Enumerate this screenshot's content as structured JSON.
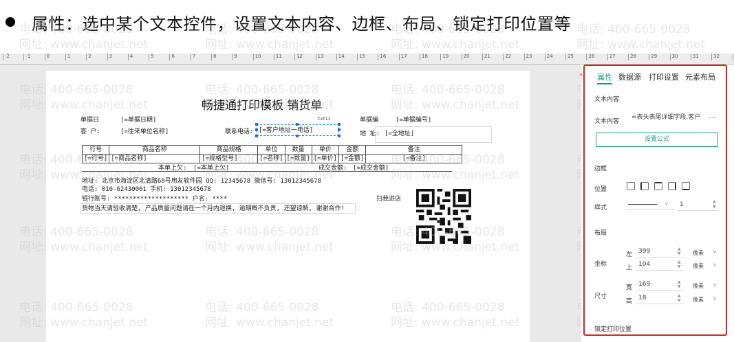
{
  "header": {
    "text": "属性：选中某个文本控件，设置文本内容、边框、布局、锁定打印位置等"
  },
  "ruler": {
    "ticks": [
      "-2",
      "-1",
      "0",
      "1",
      "2",
      "3",
      "4",
      "5",
      "6",
      "7",
      "8",
      "9",
      "10",
      "11",
      "12",
      "13",
      "14",
      "15",
      "16",
      "17",
      "18",
      "19",
      "20",
      "21",
      "22",
      "23",
      "24",
      "25",
      "26",
      "27",
      "28",
      "29",
      "30",
      "31",
      "32",
      "33"
    ]
  },
  "watermark": {
    "phone": "电话: 400-665-0028",
    "site": "网址: www.chanjet.net"
  },
  "report": {
    "title": "畅捷通打印模板 销货单",
    "doc_date_label": "单据日",
    "doc_date_value": "[=单据日期]",
    "customer_label": "客 户:",
    "customer_value": "[=往来单位名称]",
    "contact_label": "联系电话:",
    "contact_value": "[=客户地址一电话]",
    "selected_tag": "txt11",
    "doc_no_label": "单据编",
    "doc_no_value": "[=单据编号]",
    "address_label": "地 址:",
    "address_value": "[=全地址]",
    "table_headers": [
      "行号",
      "商品名称",
      "商品规格",
      "单位",
      "数量",
      "单价",
      "金额",
      "备注"
    ],
    "table_row": [
      "[=行号]",
      "[=商品名称]",
      "[=规格型号]",
      "[=名称]",
      "[=数量]",
      "[=单价]",
      "[=金额]",
      "[=备注]"
    ],
    "prev_owed_label": "本单上欠:",
    "prev_owed_value": "[=本单上欠]",
    "deal_amount_label": "成交金额:",
    "deal_amount_value": "[=成交金额]",
    "footer_line1": "地址: 北京市海淀区北清路68号用友软件园 QQ: 12345678 微信号: 13012345678",
    "footer_line2": "电话: 010-62430001 手机: 13012345678",
    "footer_line3": "银行账号: ******************** 户名: ****",
    "footer_line4": "货物当天请验收清楚, 产品质量问题请在一个月内退换, 逾期概不负责, 还望谅解, 谢谢合作!",
    "qr_label": "扫我进店"
  },
  "panel": {
    "tabs": [
      "属性",
      "数据源",
      "打印设置",
      "元素布局"
    ],
    "active_tab": "属性",
    "text_content_section": "文本内容",
    "text_content_label": "文本内容",
    "text_content_value": "=表头表尾详细字段.客户",
    "more_icon": "more-dots-icon",
    "formula_button": "设置公式",
    "border_section": "边框",
    "position_label": "位置",
    "style_label": "样式",
    "line_width": "1",
    "layout_section": "布局",
    "coord_label": "坐标",
    "left_label": "左",
    "left_value": "399",
    "top_label": "上",
    "top_value": "104",
    "size_label": "尺寸",
    "width_label": "宽",
    "width_value": "169",
    "height_label": "高",
    "height_value": "18",
    "unit": "像素",
    "lock_label": "锁定打印位置",
    "accent_color": "#1a9b8a",
    "highlight_color": "#e02020"
  }
}
